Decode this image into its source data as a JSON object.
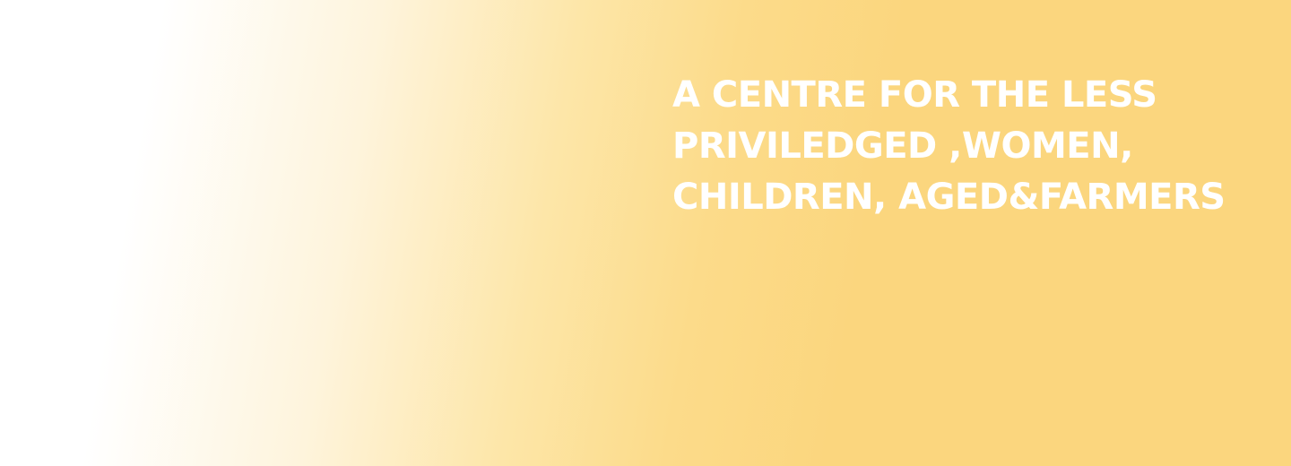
{
  "hero": {
    "heading_lines": [
      "A CENTRE FOR THE LESS",
      "PRIVILEDGED ,WOMEN,",
      "CHILDREN, AGED&FARMERS"
    ]
  },
  "colors": {
    "background_start": "#ffffff",
    "background_end": "#fbd67e",
    "heading_text": "#ffffff"
  }
}
